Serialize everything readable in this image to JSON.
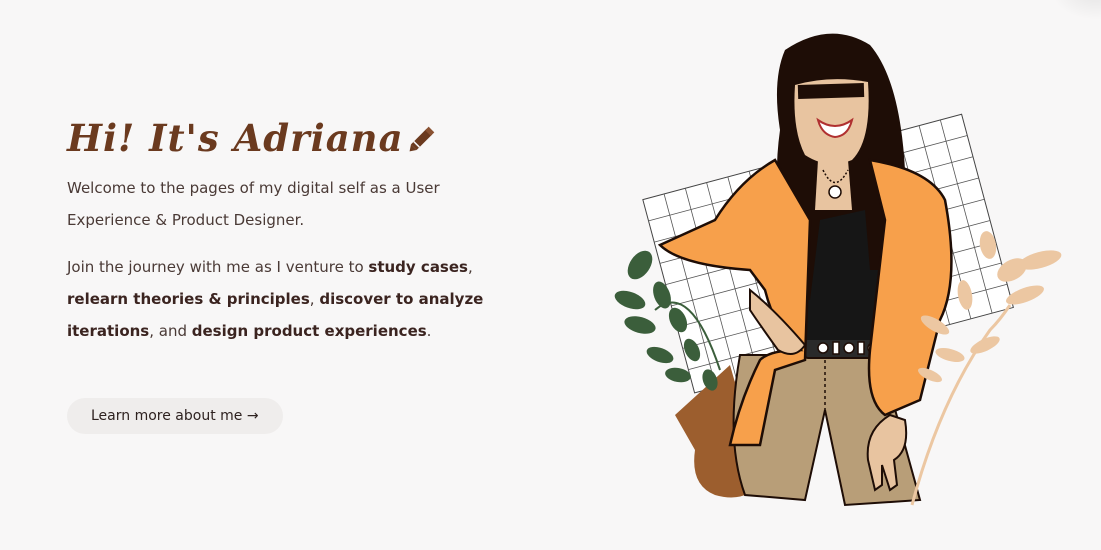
{
  "hero": {
    "greeting": "Hi! It's Adriana",
    "intro": "Welcome to the pages of my digital self as a User Experience & Product Designer.",
    "journey": {
      "t1": "Join the journey with me as I venture to ",
      "b1": "study cases",
      "t2": ", ",
      "b2": "relearn theories & principles",
      "t3": ", ",
      "b3": "discover to analyze iterations",
      "t4": ", and ",
      "b4": "design product experiences",
      "t5": "."
    },
    "cta_label": "Learn more about me →"
  },
  "icons": {
    "greeting_icon": "pencil-icon"
  },
  "colors": {
    "background": "#f8f7f7",
    "greeting": "#6b3a1f",
    "jacket": "#f7a04b",
    "hair": "#1e0d06",
    "pants": "#b89e78",
    "pot": "#a0612f",
    "leaves": "#3b5e3b",
    "branch": "#ecc7a2",
    "button_bg": "#efedec"
  }
}
